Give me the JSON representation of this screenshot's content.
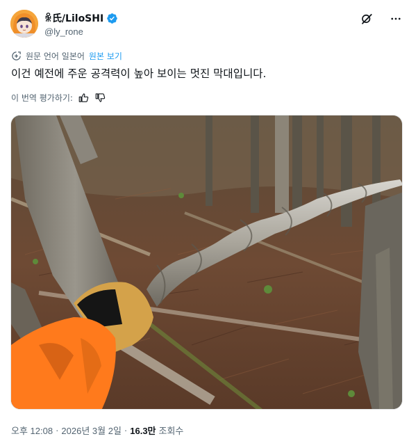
{
  "author": {
    "display_name": "ꆜ氏/LiloSHI",
    "handle": "@ly_rone",
    "verified": true,
    "avatar_icon": "avatar-anime-orange-hood"
  },
  "header_actions": {
    "grok_icon": "grok-icon",
    "more_icon": "more-icon"
  },
  "translation": {
    "notice": "원문 언어 일본어",
    "show_original": "원본 보기",
    "rate_label": "이 번역 평가하기:"
  },
  "tweet": {
    "text": "이건 예전에 주운 공격력이 높아 보이는 멋진 막대입니다."
  },
  "media": {
    "type": "photo",
    "subject": "twisted-stick-in-forest"
  },
  "meta": {
    "time": "오후 12:08",
    "date": "2026년 3월 2일",
    "views_count": "16.3만",
    "views_label": "조회수",
    "separator": "·"
  },
  "colors": {
    "accent": "#1d9bf0",
    "text": "#0f1419",
    "muted": "#536471"
  }
}
